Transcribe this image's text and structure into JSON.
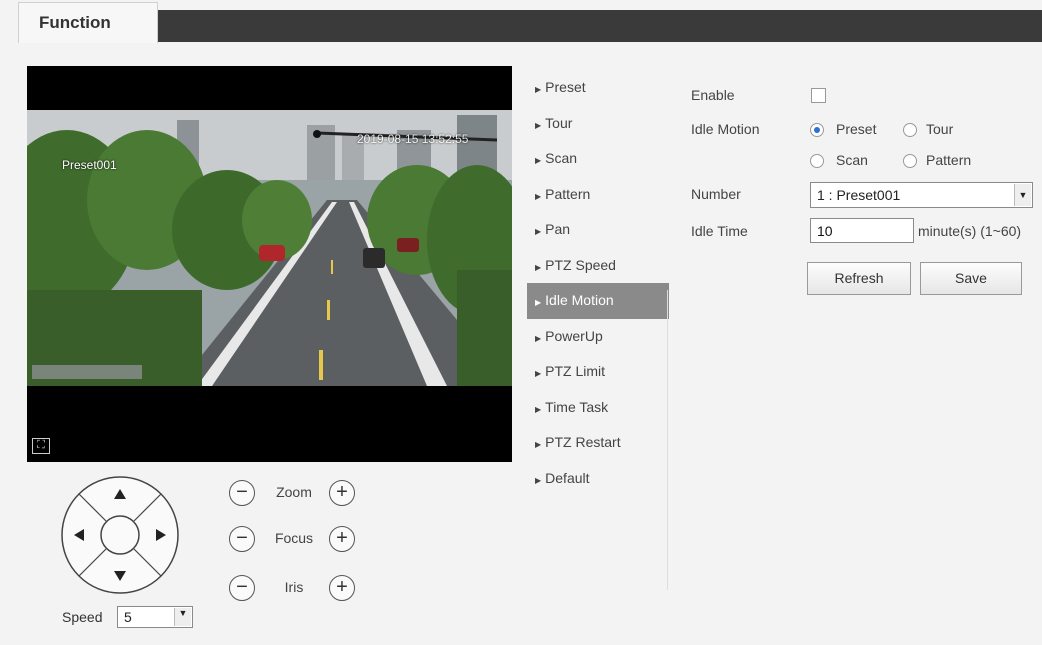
{
  "tabs": {
    "function_label": "Function"
  },
  "video": {
    "timestamp": "2019-08-15 13:52:55",
    "preset_osd": "Preset001"
  },
  "ptz": {
    "zoom_label": "Zoom",
    "focus_label": "Focus",
    "iris_label": "Iris",
    "minus": "−",
    "plus": "+",
    "speed_label": "Speed",
    "speed_value": "5"
  },
  "menu": {
    "items": [
      {
        "label": "Preset"
      },
      {
        "label": "Tour"
      },
      {
        "label": "Scan"
      },
      {
        "label": "Pattern"
      },
      {
        "label": "Pan"
      },
      {
        "label": "PTZ Speed"
      },
      {
        "label": "Idle Motion"
      },
      {
        "label": "PowerUp"
      },
      {
        "label": "PTZ Limit"
      },
      {
        "label": "Time Task"
      },
      {
        "label": "PTZ Restart"
      },
      {
        "label": "Default"
      }
    ],
    "active_index": 6
  },
  "form": {
    "enable_label": "Enable",
    "enable_checked": false,
    "idle_motion_label": "Idle Motion",
    "options": {
      "preset": "Preset",
      "tour": "Tour",
      "scan": "Scan",
      "pattern": "Pattern"
    },
    "selected_option": "Preset",
    "number_label": "Number",
    "number_value": "1 : Preset001",
    "idle_time_label": "Idle Time",
    "idle_time_value": "10",
    "idle_time_unit": "minute(s) (1~60)",
    "refresh_label": "Refresh",
    "save_label": "Save"
  },
  "colors": {
    "tab_bar": "#3a3a3a",
    "menu_active": "#8a8a8a",
    "radio_on": "#2f6fd6"
  }
}
